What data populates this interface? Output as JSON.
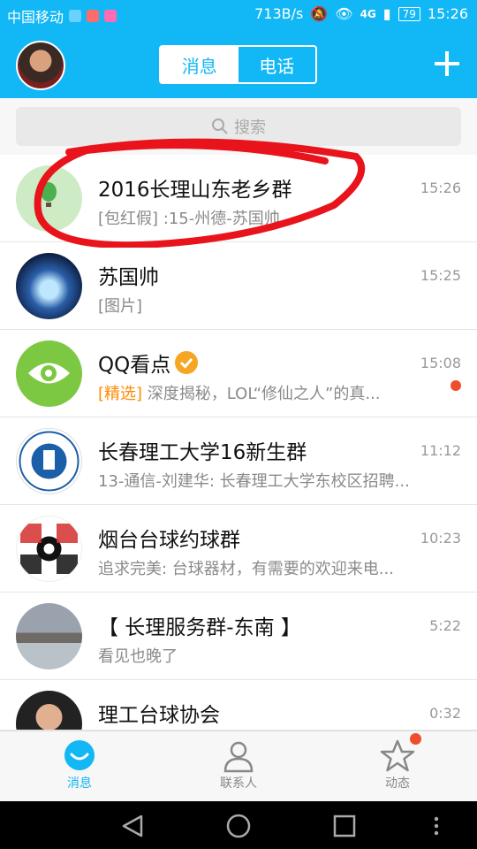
{
  "status_bar": {
    "carrier": "中国移动",
    "speed": "713B/s",
    "network": "4G",
    "battery": "79",
    "time": "15:26"
  },
  "header": {
    "tabs": [
      {
        "label": "消息",
        "active": true
      },
      {
        "label": "电话",
        "active": false
      }
    ]
  },
  "search": {
    "placeholder": "搜索"
  },
  "conversations": [
    {
      "name": "2016长理山东老乡群",
      "preview": "[包红假] :15-州德-苏国帅",
      "time": "15:26"
    },
    {
      "name": "苏国帅",
      "preview": "[图片]",
      "time": "15:25"
    },
    {
      "name": "QQ看点",
      "preview_tag": "[精选]",
      "preview": " 深度揭秘，LOL“修仙之人”的真...",
      "time": "15:08",
      "unread_dot": true
    },
    {
      "name": "长春理工大学16新生群",
      "preview": "13-通信-刘建华: 长春理工大学东校区招聘...",
      "time": "11:12"
    },
    {
      "name": "烟台台球约球群",
      "preview": "追求完美: 台球器材，有需要的欢迎来电...",
      "time": "10:23"
    },
    {
      "name": "【 长理服务群-东南 】",
      "preview": "看见也晚了",
      "time": "5:22"
    },
    {
      "name": "理工台球协会",
      "preview": "",
      "time": "0:32"
    }
  ],
  "tabbar": {
    "messages": "消息",
    "contacts": "联系人",
    "moments": "动态"
  },
  "colors": {
    "accent": "#12b7f5",
    "badge": "#f04d2d",
    "annotation": "#e8131b"
  }
}
